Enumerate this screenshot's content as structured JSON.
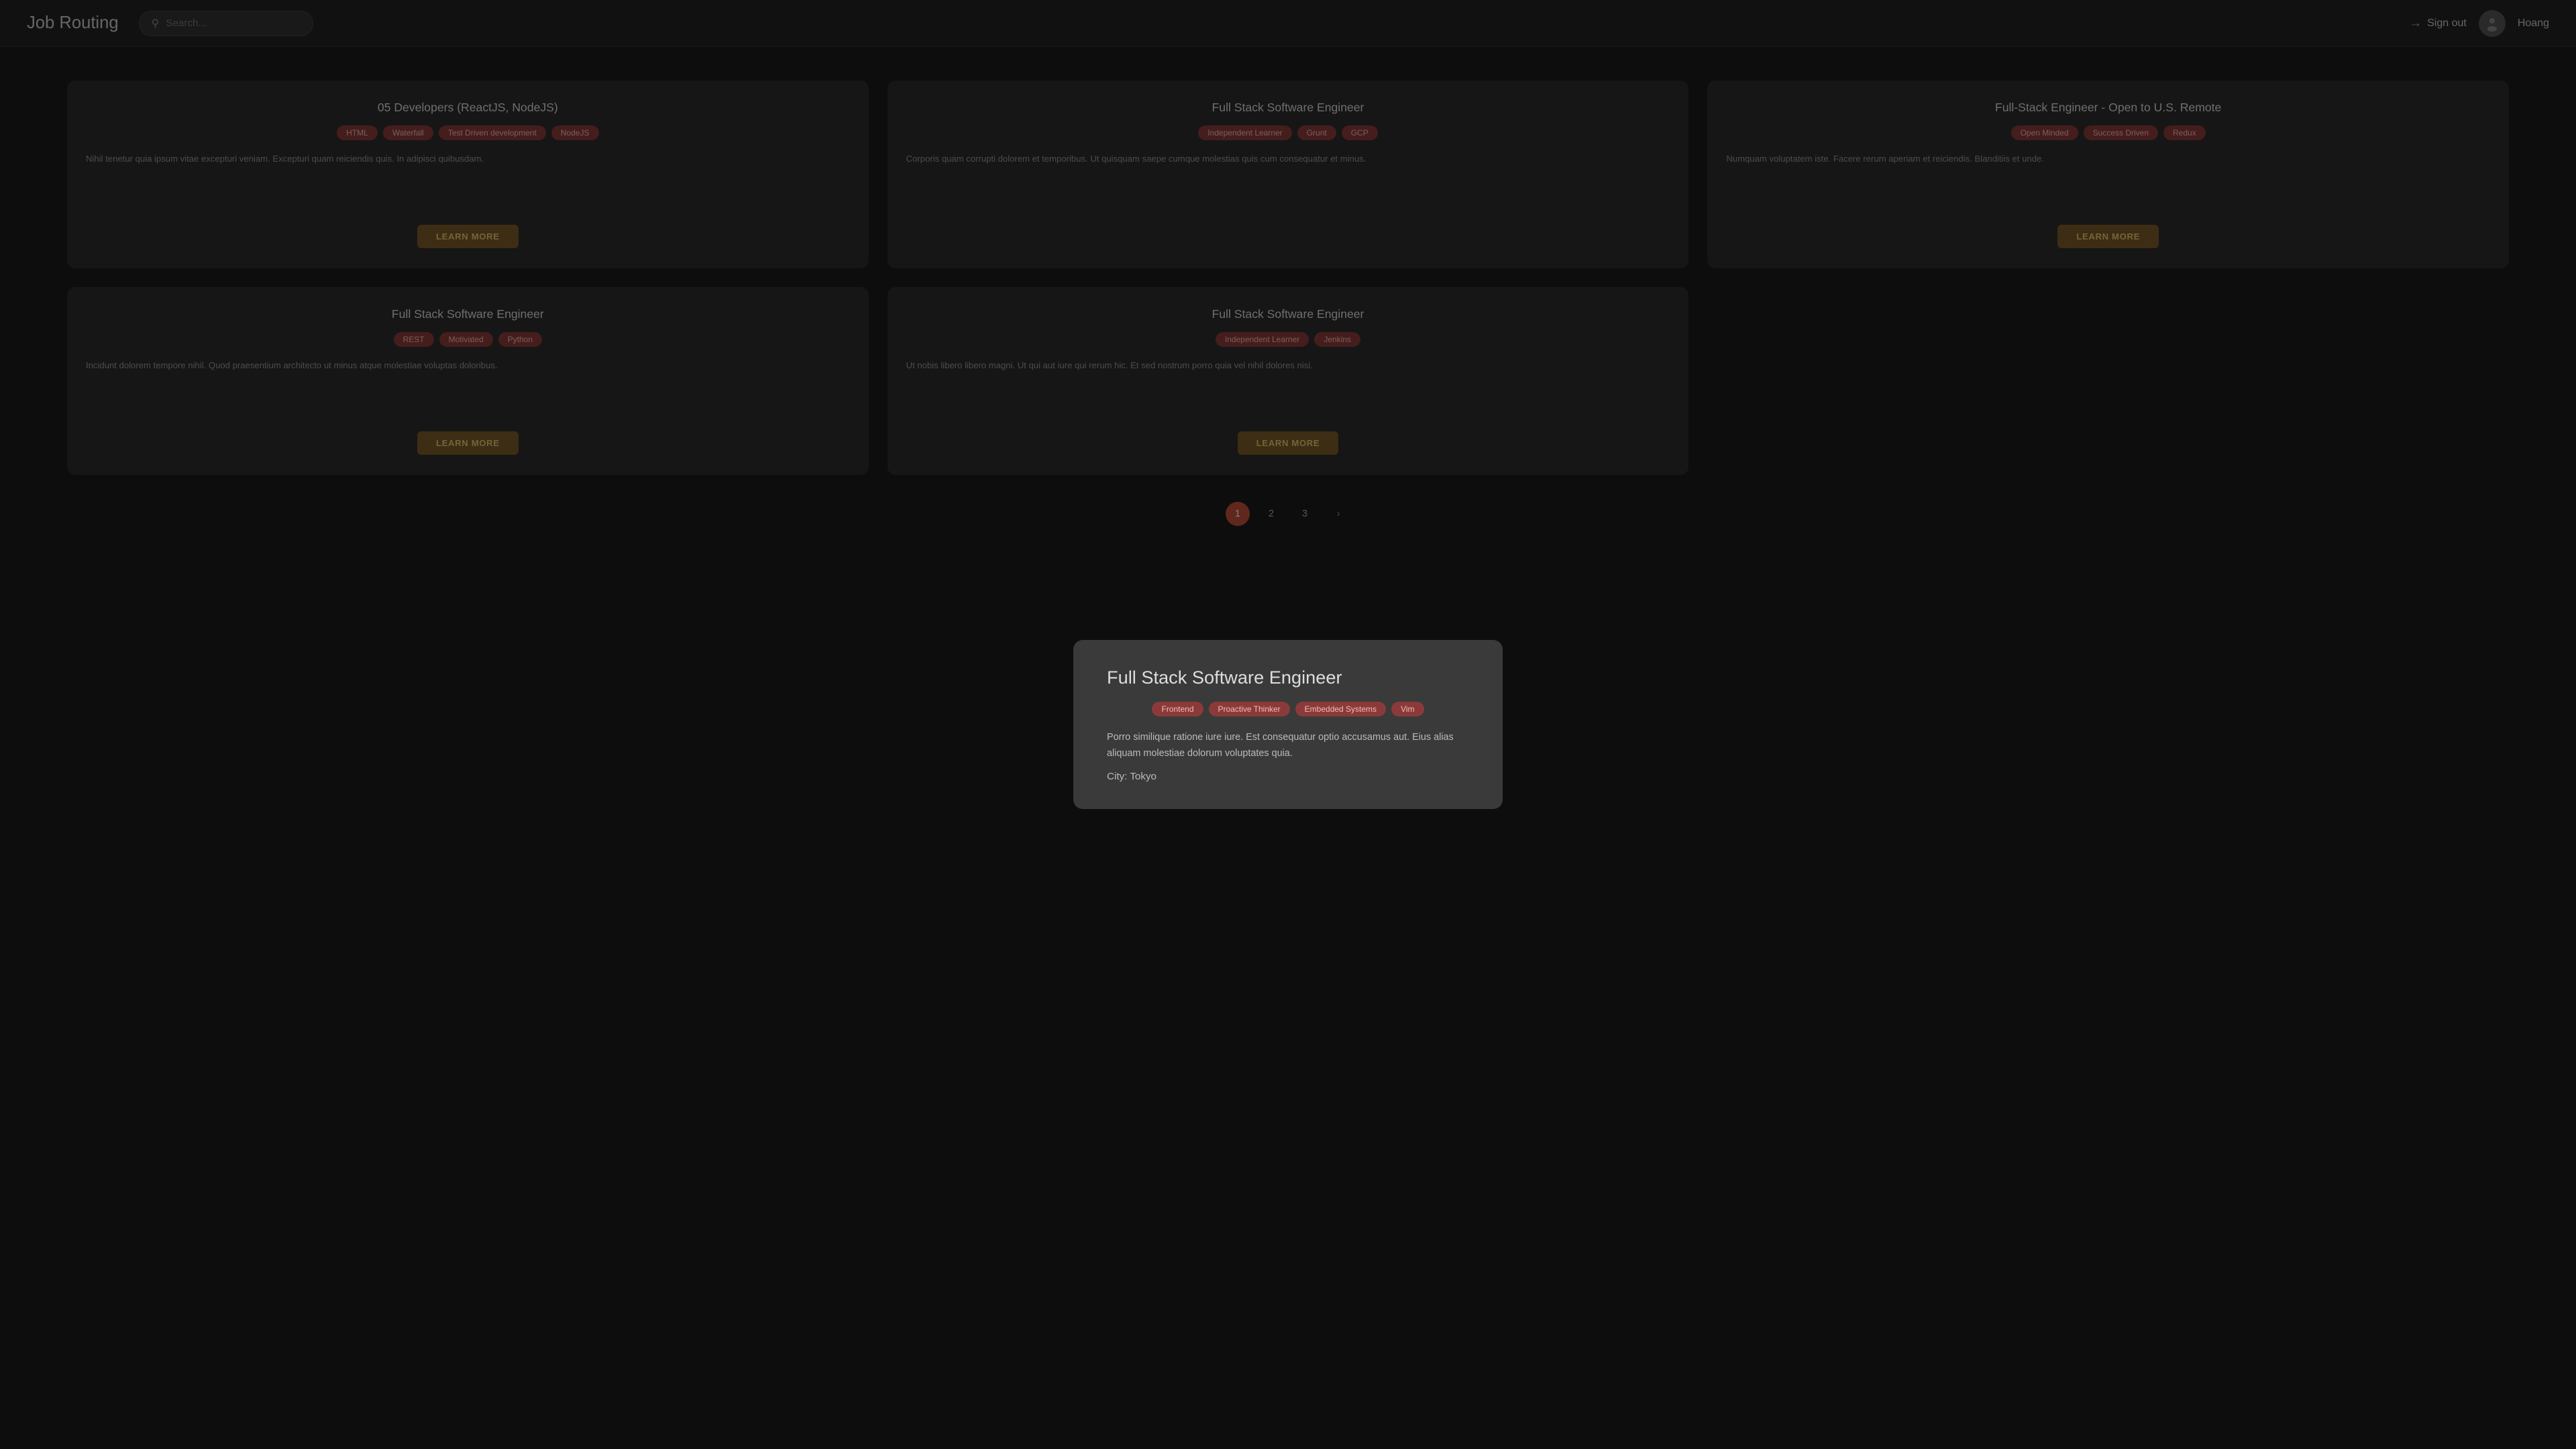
{
  "header": {
    "title": "Job Routing",
    "search_placeholder": "Search...",
    "signout_label": "Sign out",
    "username": "Hoang"
  },
  "cards": [
    {
      "id": "card-1",
      "title": "05 Developers (ReactJS, NodeJS)",
      "tags": [
        "HTML",
        "Waterfall",
        "Test Driven development",
        "NodeJS"
      ],
      "desc": "Nihil tenetur quia ipsum vitae excepturi veniam. Excepturi quam reiciendis quis. In adipisci quibusdam.",
      "learn_more_label": "LEARN MORE"
    },
    {
      "id": "card-2",
      "title": "Full Stack Software Engineer",
      "tags": [
        "Independent Learner",
        "Grunt",
        "GCP"
      ],
      "desc": "Corporis quam corrupti dolorem et temporibus. Ut quisquam saepe cumque molestias quis cum consequatur et minus.",
      "learn_more_label": "LEARN MORE"
    },
    {
      "id": "card-3",
      "title": "Full-Stack Engineer - Open to U.S. Remote",
      "tags": [
        "Open Minded",
        "Success Driven",
        "Redux"
      ],
      "desc": "Numquam voluptatem iste. Facere rerum aperiam et reiciendis. Blanditiis et unde.",
      "learn_more_label": "LEARN MORE"
    },
    {
      "id": "card-4",
      "title": "Full Stack Software Engineer",
      "tags": [
        "REST",
        "Motivated",
        "Python"
      ],
      "desc": "Incidunt dolorem tempore nihil. Quod praesentium architecto ut minus atque molestiae voluptas doloribus.",
      "learn_more_label": "LEARN MORE"
    },
    {
      "id": "card-5",
      "title": "Full Stack Software Engineer",
      "tags": [
        "Independent Learner",
        "Jenkins"
      ],
      "desc": "Ut nobis libero libero magni. Ut qui aut iure qui rerum hic. Et sed nostrum porro quia vel nihil dolores nisi.",
      "learn_more_label": "LEARN MORE"
    }
  ],
  "modal": {
    "title": "Full Stack Software Engineer",
    "tags": [
      "Frontend",
      "Proactive Thinker",
      "Embedded Systems",
      "Vim"
    ],
    "desc": "Porro similique ratione iure iure. Est consequatur optio accusamus aut. Eius alias aliquam molestiae dolorum voluptates quia.",
    "city_label": "City:",
    "city": "Tokyo"
  },
  "pagination": {
    "pages": [
      "1",
      "2",
      "3"
    ],
    "active": "1",
    "next_label": "›"
  },
  "learn_more_label": "LEARN MORE"
}
